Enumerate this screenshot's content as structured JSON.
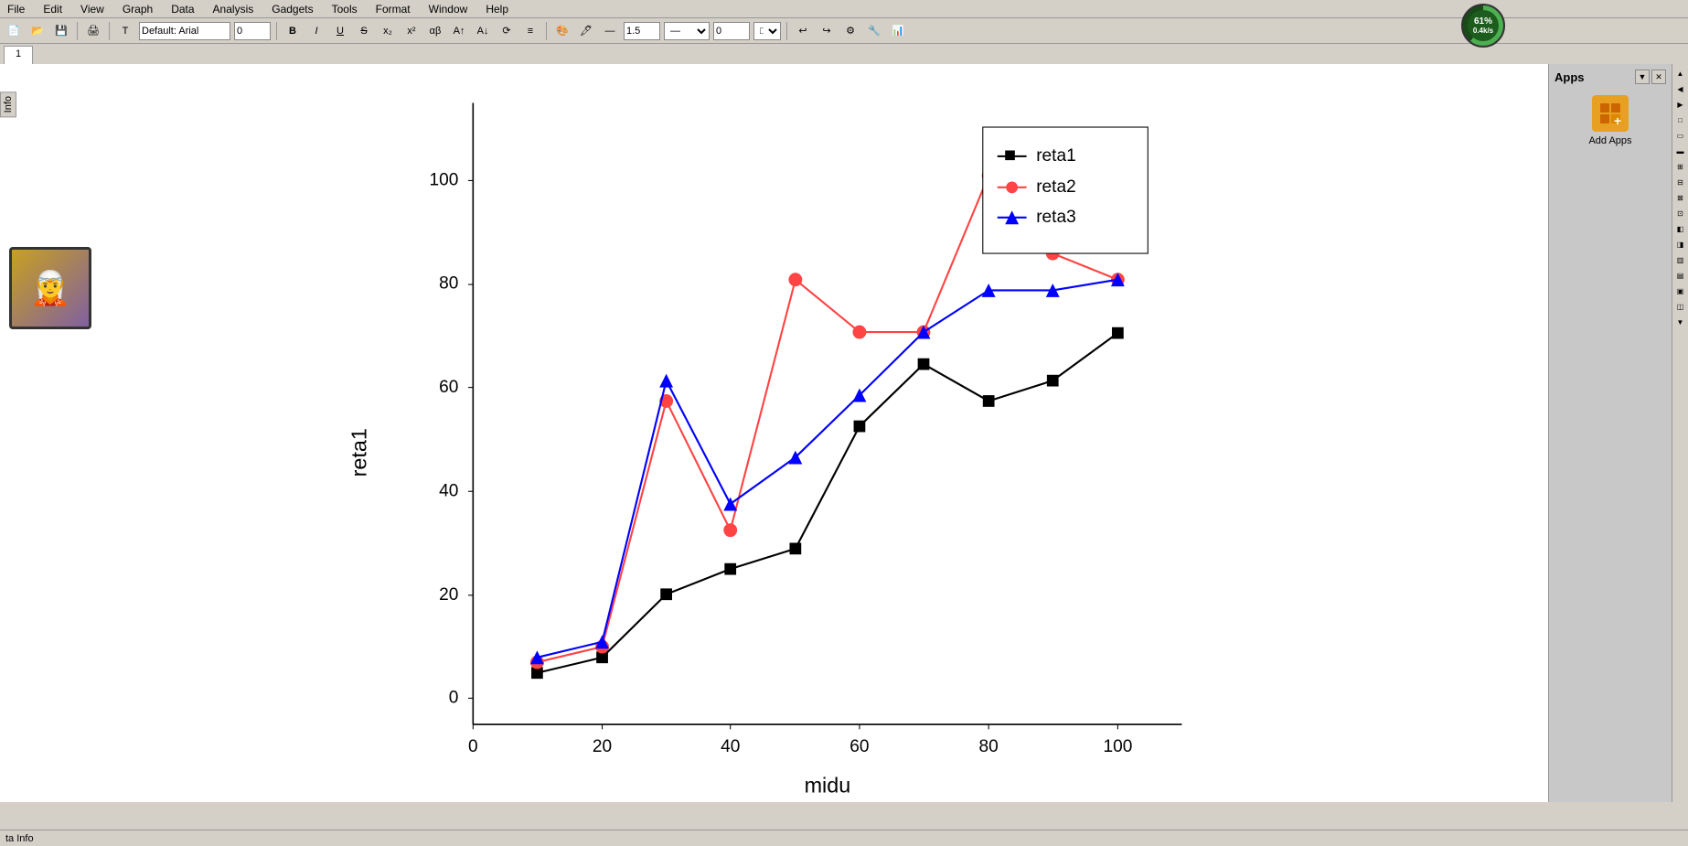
{
  "menubar": {
    "items": [
      "File",
      "Edit",
      "View",
      "Graph",
      "Data",
      "Analysis",
      "Gadgets",
      "Tools",
      "Format",
      "Window",
      "Help"
    ]
  },
  "toolbar": {
    "font_name": "Default: Arial",
    "font_size": "0",
    "line_width": "1.5",
    "box_width": "0",
    "box_value": "0"
  },
  "toolbar2": {
    "info_label": "ta Info"
  },
  "tabs": [
    {
      "label": "1",
      "active": true
    }
  ],
  "chart": {
    "title": "",
    "x_label": "midu",
    "y_label": "reta1",
    "x_min": 0,
    "x_max": 110,
    "y_min": -5,
    "y_max": 115,
    "x_ticks": [
      0,
      20,
      40,
      60,
      80,
      100
    ],
    "y_ticks": [
      0,
      20,
      40,
      60,
      80,
      100
    ],
    "series": [
      {
        "name": "reta1",
        "color": "#000000",
        "marker": "square",
        "points": [
          [
            10,
            3
          ],
          [
            20,
            6
          ],
          [
            30,
            20
          ],
          [
            40,
            28
          ],
          [
            50,
            32
          ],
          [
            60,
            55
          ],
          [
            70,
            67
          ],
          [
            80,
            60
          ],
          [
            90,
            64
          ],
          [
            100,
            73
          ]
        ]
      },
      {
        "name": "reta2",
        "color": "#ff4444",
        "marker": "circle",
        "points": [
          [
            10,
            5
          ],
          [
            20,
            8
          ],
          [
            30,
            60
          ],
          [
            40,
            35
          ],
          [
            50,
            82
          ],
          [
            60,
            72
          ],
          [
            70,
            72
          ],
          [
            80,
            100
          ],
          [
            90,
            86
          ],
          [
            100,
            82
          ]
        ]
      },
      {
        "name": "reta3",
        "color": "#0000ff",
        "marker": "triangle",
        "points": [
          [
            10,
            6
          ],
          [
            20,
            9
          ],
          [
            30,
            64
          ],
          [
            40,
            40
          ],
          [
            50,
            49
          ],
          [
            60,
            62
          ],
          [
            70,
            72
          ],
          [
            80,
            80
          ],
          [
            90,
            80
          ],
          [
            100,
            82
          ]
        ]
      }
    ],
    "legend": {
      "items": [
        {
          "label": "reta1",
          "color": "#000000",
          "marker": "square"
        },
        {
          "label": "reta2",
          "color": "#ff4444",
          "marker": "circle"
        },
        {
          "label": "reta3",
          "color": "#0000ff",
          "marker": "triangle"
        }
      ]
    }
  },
  "apps_panel": {
    "title": "Apps",
    "add_label": "Add Apps"
  },
  "cpu": {
    "percent": "61%",
    "rate": "0.4k/s"
  },
  "info_tab": {
    "label": "Info"
  },
  "status": {
    "text": "ta Info"
  }
}
